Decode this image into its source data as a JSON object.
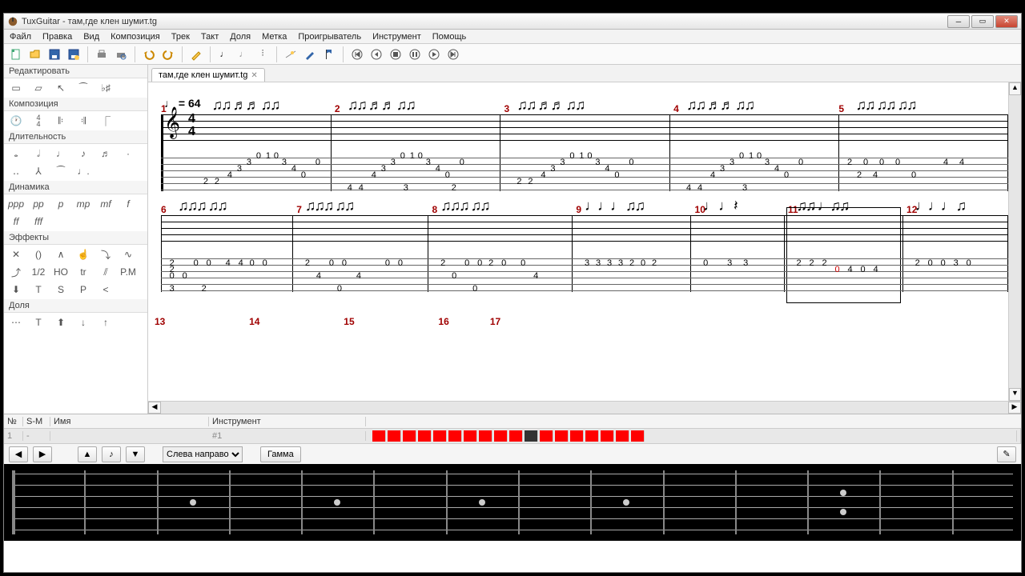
{
  "window": {
    "title": "TuxGuitar - там,где клен шумит.tg"
  },
  "menu": [
    "Файл",
    "Правка",
    "Вид",
    "Композиция",
    "Трек",
    "Такт",
    "Доля",
    "Метка",
    "Проигрыватель",
    "Инструмент",
    "Помощь"
  ],
  "tab": {
    "label": "там,где клен шумит.tg"
  },
  "sidebar": {
    "panels": [
      {
        "title": "Редактировать"
      },
      {
        "title": "Композиция"
      },
      {
        "title": "Длительность"
      },
      {
        "title": "Динамика"
      },
      {
        "title": "Эффекты"
      },
      {
        "title": "Доля"
      }
    ],
    "dynamics": [
      "ppp",
      "pp",
      "p",
      "mp",
      "mf",
      "f",
      "ff",
      "fff"
    ],
    "effects": [
      "✕",
      "()",
      "∧",
      "☝",
      "⤵",
      "∿",
      "⤴",
      "1/2",
      "HO",
      "tr",
      "⫽",
      "P.M",
      "⬇",
      "T",
      "S",
      "P",
      "<"
    ],
    "beat": [
      "⋯",
      "T",
      "⬆",
      "↓",
      "↑"
    ]
  },
  "score": {
    "tempo": "♩ = 64",
    "timesig_top": "4",
    "timesig_bot": "4",
    "measures_row1": [
      "1",
      "2",
      "3",
      "4",
      "5"
    ],
    "measures_row2": [
      "6",
      "7",
      "8",
      "9",
      "10",
      "11",
      "12"
    ],
    "measures_row3": [
      "13",
      "14",
      "15",
      "16",
      "17"
    ],
    "tab_row1_pattern": "2 2 4 3 3 0 1 0 3 4 0 0",
    "tab_row1_bass": "4 4   3   2",
    "tab_m5": "2 0 0 0 0 4 4 / 2 4 0",
    "tab_row2_m6": "2 0 0 0 0 4 4 0 0 / 3 0  2",
    "tab_row2_m7": "2 4 0 0 4 0 0 / 0",
    "tab_row2_m8": "2 0 0 2 0 0 4 / 0",
    "tab_row2_m9": "3 3 3 3 2 0 2",
    "tab_row2_m10": "0 3 3",
    "tab_row2_m11": "2 2 2 0 4 0 4",
    "tab_row2_m12": "2 0 0 3 0",
    "selected_measure": 11
  },
  "trackpanel": {
    "headers": {
      "no": "№",
      "sm": "S-M",
      "name": "Имя",
      "inst": "Инструмент"
    },
    "row": {
      "no": "1",
      "sm": "-",
      "name": "",
      "inst": "#1"
    },
    "volume_segments": 18,
    "volume_current": 11
  },
  "bottom": {
    "direction": "Слева направо",
    "gamma": "Гамма"
  },
  "fretboard": {
    "strings": 6,
    "frets": 13,
    "dots_single": [
      3,
      5,
      7,
      9
    ],
    "dots_double": 12
  }
}
